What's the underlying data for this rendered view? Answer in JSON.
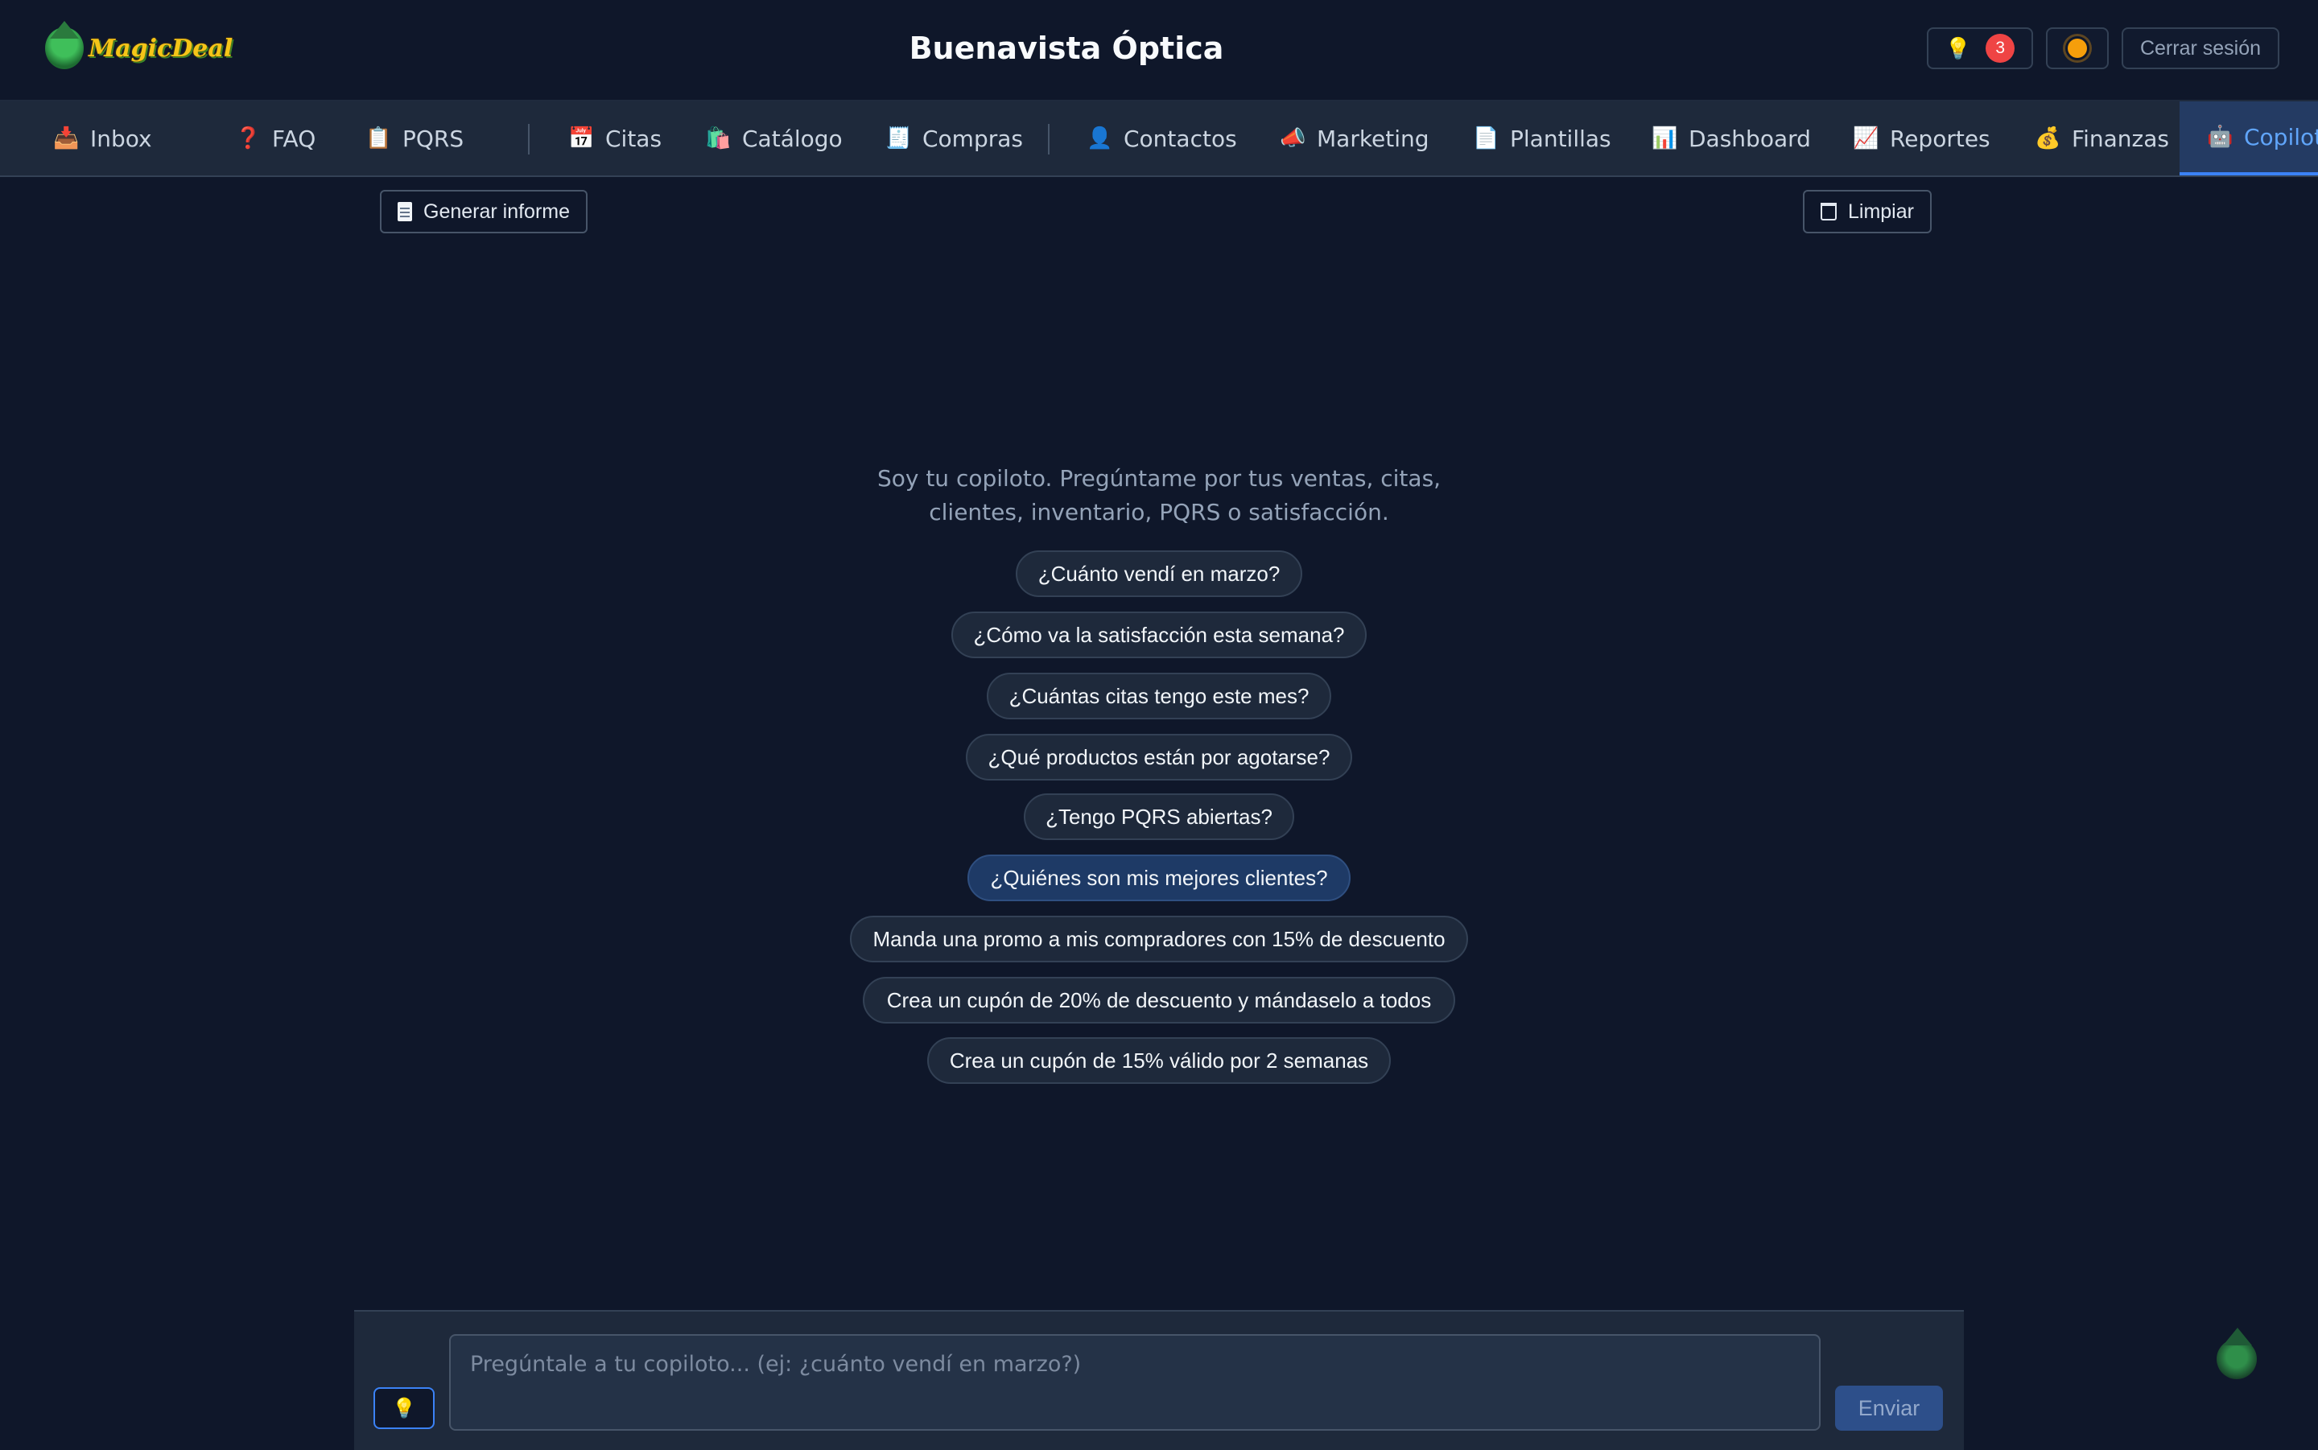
{
  "header": {
    "logo_text": "MagicDeal",
    "title": "Buenavista Óptica",
    "ideas_badge": "3",
    "logout_label": "Cerrar sesión",
    "bulb_glyph": "💡"
  },
  "nav": {
    "items": [
      {
        "icon": "📥",
        "label": "Inbox"
      },
      {
        "icon": "❓",
        "label": "FAQ"
      },
      {
        "icon": "📋",
        "label": "PQRS"
      },
      {
        "icon": "📅",
        "label": "Citas"
      },
      {
        "icon": "🛍️",
        "label": "Catálogo"
      },
      {
        "icon": "🧾",
        "label": "Compras"
      },
      {
        "icon": "👤",
        "label": "Contactos"
      },
      {
        "icon": "📣",
        "label": "Marketing"
      },
      {
        "icon": "📄",
        "label": "Plantillas"
      },
      {
        "icon": "📊",
        "label": "Dashboard"
      },
      {
        "icon": "📈",
        "label": "Reportes"
      },
      {
        "icon": "💰",
        "label": "Finanzas"
      },
      {
        "icon": "🤖",
        "label": "Copiloto"
      }
    ],
    "active": "Copiloto"
  },
  "toolbar": {
    "report_label": "Generar informe",
    "clear_label": "Limpiar"
  },
  "main": {
    "welcome": "Soy tu copiloto. Pregúntame por tus ventas, citas, clientes, inventario, PQRS o satisfacción.",
    "suggestions": [
      "¿Cuánto vendí en marzo?",
      "¿Cómo va la satisfacción esta semana?",
      "¿Cuántas citas tengo este mes?",
      "¿Qué productos están por agotarse?",
      "¿Tengo PQRS abiertas?",
      "¿Quiénes son mis mejores clientes?",
      "Manda una promo a mis compradores con 15% de descuento",
      "Crea un cupón de 20% de descuento y mándaselo a todos",
      "Crea un cupón de 15% válido por 2 semanas"
    ]
  },
  "composer": {
    "placeholder": "Pregúntale a tu copiloto... (ej: ¿cuánto vendí en marzo?)",
    "send_label": "Enviar"
  },
  "colors": {
    "background": "#0f172a",
    "accent": "#3b82f6",
    "badge": "#ef4444"
  }
}
